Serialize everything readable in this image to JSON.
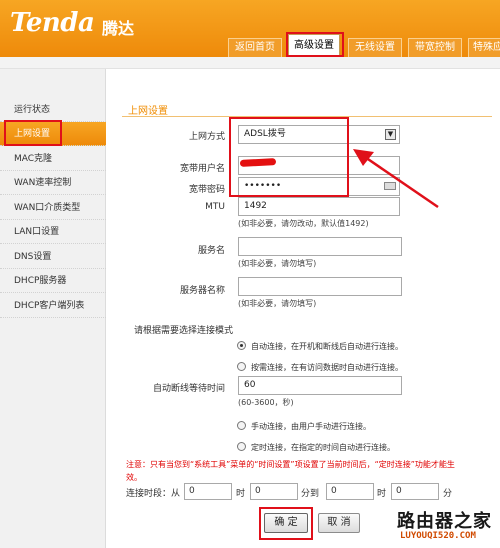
{
  "header": {
    "logo": "Tenda",
    "logo_cn": "腾达",
    "tabs": [
      {
        "label": "返回首页"
      },
      {
        "label": "高级设置"
      },
      {
        "label": "无线设置"
      },
      {
        "label": "带宽控制"
      },
      {
        "label": "特殊应"
      }
    ],
    "active_tab": "高级设置"
  },
  "sidebar": {
    "items": [
      {
        "label": "运行状态"
      },
      {
        "label": "上网设置"
      },
      {
        "label": "MAC克隆"
      },
      {
        "label": "WAN速率控制"
      },
      {
        "label": "WAN口介质类型"
      },
      {
        "label": "LAN口设置"
      },
      {
        "label": "DNS设置"
      },
      {
        "label": "DHCP服务器"
      },
      {
        "label": "DHCP客户端列表"
      }
    ],
    "active_item": "上网设置"
  },
  "form": {
    "section_title": "上网设置",
    "conn_type": {
      "label": "上网方式",
      "value": "ADSL拨号"
    },
    "username": {
      "label": "宽带用户名",
      "value": ""
    },
    "password": {
      "label": "宽带密码",
      "value": "•••••••"
    },
    "mtu": {
      "label": "MTU",
      "value": "1492",
      "hint": "(如非必要，请勿改动，默认值1492)"
    },
    "service_name": {
      "label": "服务名",
      "value": "",
      "hint": "(如非必要，请勿填写)"
    },
    "server_name": {
      "label": "服务器名称",
      "value": "",
      "hint": "(如非必要，请勿填写)"
    },
    "mode_label": "请根据需要选择连接模式",
    "modes": [
      {
        "label": "自动连接，在开机和断线后自动进行连接。",
        "checked": true
      },
      {
        "label": "按需连接，在有访问数据时自动进行连接。",
        "checked": false
      },
      {
        "label": "手动连接，由用户手动进行连接。",
        "checked": false
      },
      {
        "label": "定时连接，在指定的时间自动进行连接。",
        "checked": false
      }
    ],
    "idle_time": {
      "label": "自动断线等待时间",
      "value": "60",
      "hint": "(60-3600，秒)"
    },
    "note": "注意：只有当您到“系统工具”菜单的“时间设置”项设置了当前时间后，“定时连接”功能才能生效。",
    "time_range": {
      "label": "连接时段：从",
      "from_hour": "0",
      "from_min": "0",
      "to_hour": "0",
      "to_min": "0",
      "hour_unit": "时",
      "min_to": "分到",
      "min_unit": "分"
    },
    "ok_label": "确 定",
    "cancel_label": "取 消"
  },
  "watermark": {
    "cn": "路由器之家",
    "url": "LUYOUQI520.COM"
  },
  "colors": {
    "accent": "#f29600",
    "highlight": "#e0101a"
  }
}
